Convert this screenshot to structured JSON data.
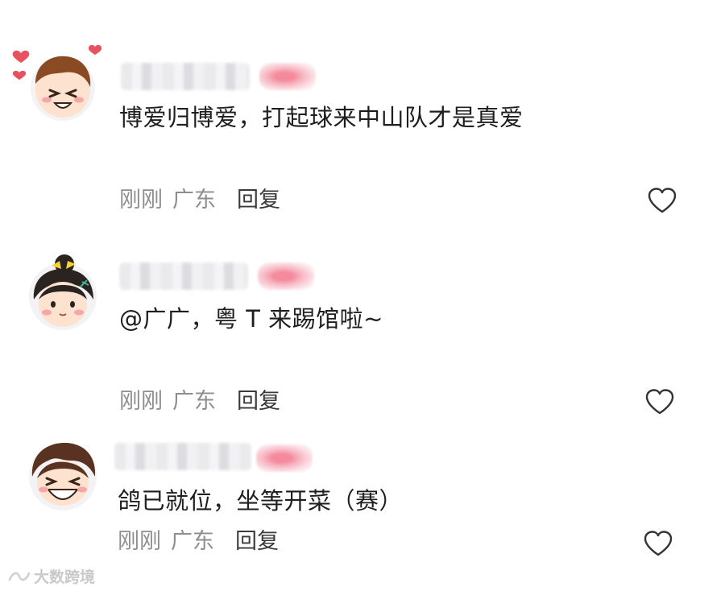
{
  "comments": [
    {
      "text": "博爱归博爱，打起球来中山队才是真爱",
      "time": "刚刚",
      "location": "广东",
      "reply_label": "回复",
      "avatar_icon": "boy-avatar-with-hearts-icon",
      "like_icon": "heart-outline-icon"
    },
    {
      "text": "@广广，粤 T 来踢馆啦~",
      "time": "刚刚",
      "location": "广东",
      "reply_label": "回复",
      "avatar_icon": "girl-avatar-bun-icon",
      "like_icon": "heart-outline-icon"
    },
    {
      "text": "鸽已就位，坐等开菜（赛）",
      "time": "刚刚",
      "location": "广东",
      "reply_label": "回复",
      "avatar_icon": "laughing-boy-avatar-icon",
      "like_icon": "heart-outline-icon"
    }
  ],
  "watermark": {
    "text": "大数跨境"
  },
  "colors": {
    "meta_gray": "#8e8e8e",
    "reply_text": "#3a3a3a",
    "badge_pink": "#f48a9c",
    "heart_red": "#e8525f"
  }
}
